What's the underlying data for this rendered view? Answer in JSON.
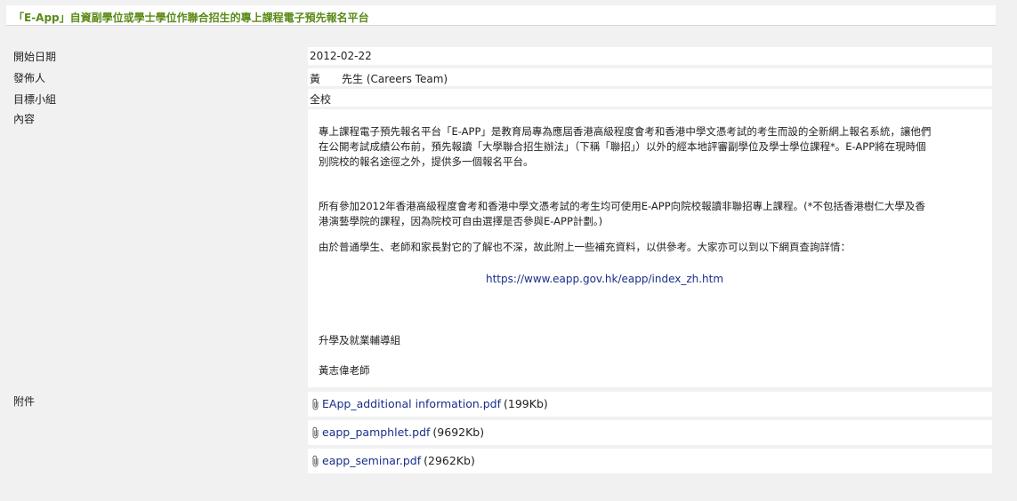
{
  "notice": {
    "title": "「E-App」自資副學位或學士學位作聯合招生的專上課程電子預先報名平台"
  },
  "fields": {
    "start_date_label": "開始日期",
    "start_date_value": "2012-02-22",
    "publisher_label": "發佈人",
    "publisher_value": "黃　　先生 (Careers Team)",
    "target_label": "目標小組",
    "target_value": "全校",
    "content_label": "內容",
    "attachments_label": "附件"
  },
  "content": {
    "para1": "專上課程電子預先報名平台「E-APP」是教育局專為應屆香港高級程度會考和香港中學文憑考試的考生而設的全新網上報名系統，讓他們在公開考試成績公布前，預先報讀「大學聯合招生辦法」（下稱「聯招」）以外的經本地評審副學位及學士學位課程*。E-APP將在現時個別院校的報名途徑之外，提供多一個報名平台。",
    "para2": "所有參加2012年香港高級程度會考和香港中學文憑考試的考生均可使用E-APP向院校報讀非聯招專上課程。(*不包括香港樹仁大學及香港演藝學院的課程，因為院校可自由選擇是否參與E-APP計劃。)",
    "para3": "由於普通學生、老師和家長對它的了解也不深，故此附上一些補充資料，以供參考。大家亦可以到以下網頁查詢詳情：",
    "link": "https://www.eapp.gov.hk/eapp/index_zh.htm",
    "signature_dept": "升學及就業輔導組",
    "signature_name": "黃志偉老師"
  },
  "attachments": [
    {
      "name": "EApp_additional information.pdf",
      "size": "(199Kb)",
      "icon": "paperclip-icon"
    },
    {
      "name": "eapp_pamphlet.pdf",
      "size": "(9692Kb)",
      "icon": "paperclip-icon"
    },
    {
      "name": "eapp_seminar.pdf",
      "size": "(2962Kb)",
      "icon": "paperclip-icon"
    }
  ]
}
